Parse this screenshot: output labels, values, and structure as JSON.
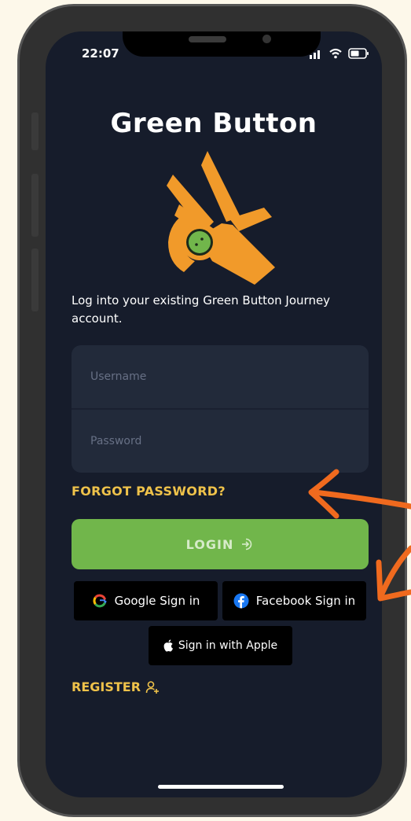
{
  "status_bar": {
    "time": "22:07"
  },
  "app": {
    "title": "Green Button"
  },
  "intro_text": "Log into your existing Green Button Journey account.",
  "form": {
    "username_placeholder": "Username",
    "password_placeholder": "Password"
  },
  "links": {
    "forgot_password": "FORGOT PASSWORD?",
    "register": "REGISTER"
  },
  "buttons": {
    "login": "LOGIN",
    "google": "Google Sign in",
    "facebook": "Facebook Sign in",
    "apple": "Sign in with Apple"
  },
  "colors": {
    "screen_bg": "#161C2B",
    "accent_yellow": "#EFC24A",
    "login_green": "#71B64B",
    "logo_orange": "#F19A2A",
    "annotation_orange": "#F06A1E"
  },
  "icons": {
    "logo": "ok-hand-button-icon",
    "login": "login-arrow-icon",
    "google": "google-icon",
    "facebook": "facebook-icon",
    "apple": "apple-icon",
    "register": "add-user-icon"
  }
}
